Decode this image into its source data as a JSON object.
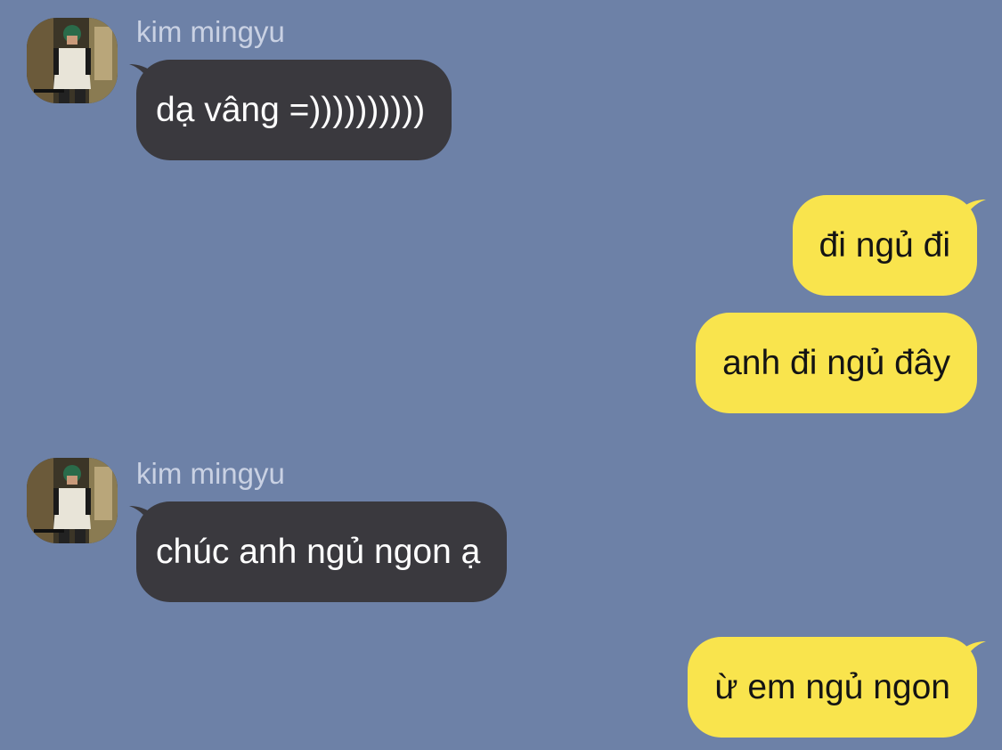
{
  "messages": [
    {
      "side": "in",
      "sender": "kim mingyu",
      "text": "dạ vâng =))))))))))"
    },
    {
      "side": "out",
      "text": "đi ngủ đi"
    },
    {
      "side": "out",
      "text": "anh đi ngủ đây"
    },
    {
      "side": "in",
      "sender": "kim mingyu",
      "text": "chúc anh ngủ ngon ạ"
    },
    {
      "side": "out",
      "text": "ừ em ngủ ngon"
    }
  ],
  "colors": {
    "background": "#6d81a7",
    "incoming_bubble": "#3a393e",
    "outgoing_bubble": "#f9e44d",
    "sender_name": "#c9d1e3"
  },
  "icons": {
    "avatar": "profile-photo"
  }
}
